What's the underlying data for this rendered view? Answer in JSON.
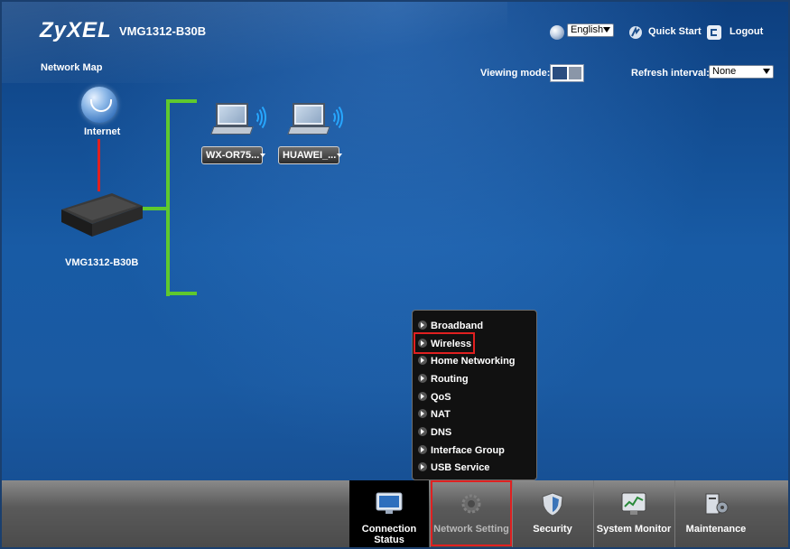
{
  "header": {
    "brand": "ZyXEL",
    "model": "VMG1312-B30B",
    "language": "English",
    "quick_start": "Quick Start",
    "logout": "Logout"
  },
  "network_map": {
    "title": "Network Map",
    "viewing_mode_label": "Viewing mode:",
    "refresh_label": "Refresh interval:",
    "refresh_value": "None",
    "internet_label": "Internet",
    "router_label": "VMG1312-B30B",
    "devices": [
      {
        "label": "WX-OR75..."
      },
      {
        "label": "HUAWEI_..."
      }
    ]
  },
  "submenu": {
    "items": [
      "Broadband",
      "Wireless",
      "Home Networking",
      "Routing",
      "QoS",
      "NAT",
      "DNS",
      "Interface Group",
      "USB Service"
    ]
  },
  "bottom_nav": {
    "items": [
      {
        "label": "Connection Status"
      },
      {
        "label": "Network Setting"
      },
      {
        "label": "Security"
      },
      {
        "label": "System Monitor"
      },
      {
        "label": "Maintenance"
      }
    ]
  },
  "colors": {
    "highlight": "#e02020",
    "link_line": "#5fc92e",
    "wan_line": "#e02020"
  }
}
